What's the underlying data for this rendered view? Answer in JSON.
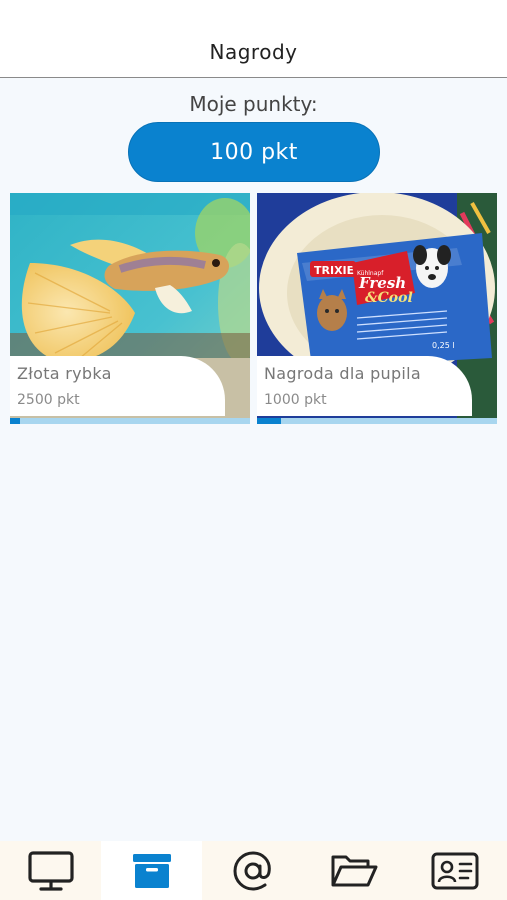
{
  "header": {
    "title": "Nagrody"
  },
  "points": {
    "label": "Moje punkty:",
    "value": "100 pkt"
  },
  "rewards": [
    {
      "name": "Złota rybka",
      "cost": "2500 pkt",
      "progress": 0.04
    },
    {
      "name": "Nagroda dla pupila",
      "cost": "1000 pkt",
      "progress": 0.1
    }
  ],
  "product_text": {
    "brand": "TRIXIE",
    "line1": "Fresh",
    "line2": "&Cool",
    "sub": "Kühlnapf",
    "volume": "0,25 l"
  },
  "colors": {
    "accent": "#0a82cf",
    "progress_track": "#a8d6ef",
    "nav_bg": "#fdf8ef"
  },
  "nav": [
    {
      "icon": "monitor-icon"
    },
    {
      "icon": "archive-box-icon",
      "active": true
    },
    {
      "icon": "at-sign-icon"
    },
    {
      "icon": "folder-open-icon"
    },
    {
      "icon": "contact-card-icon"
    }
  ]
}
